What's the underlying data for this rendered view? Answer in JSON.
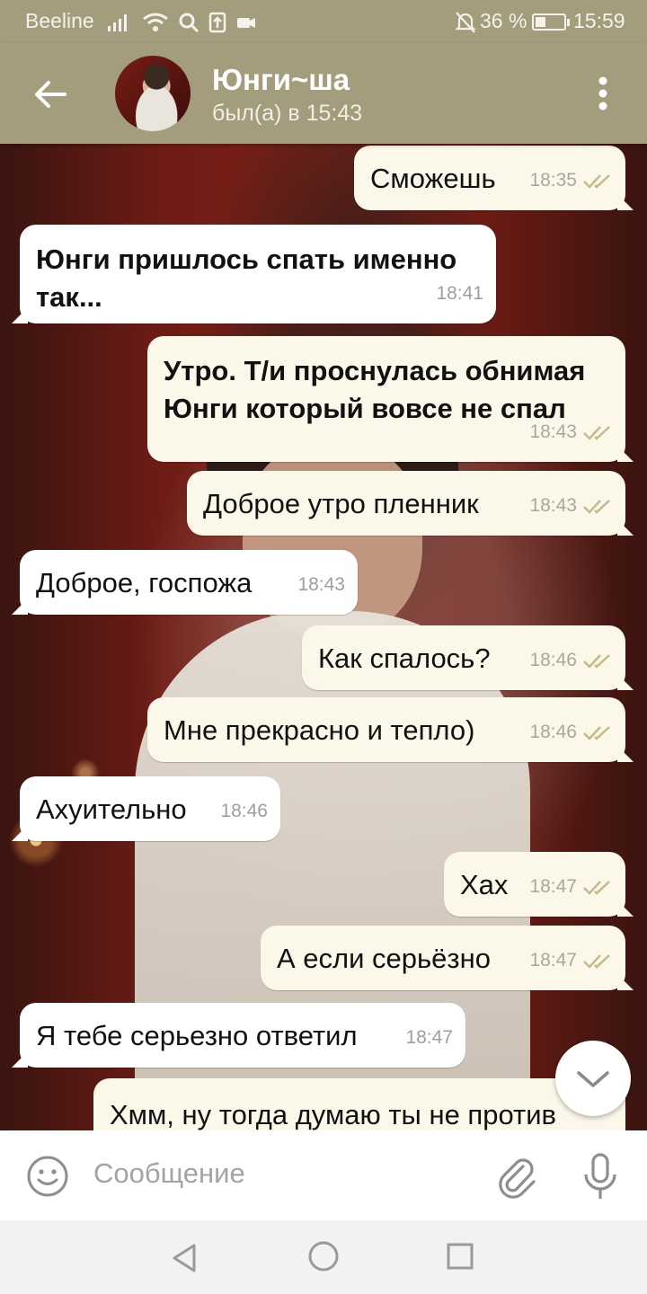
{
  "status_bar": {
    "carrier": "Beeline",
    "battery_percent": "36 %",
    "time": "15:59"
  },
  "header": {
    "contact_name": "Юнги~ша",
    "last_seen": "был(а) в 15:43"
  },
  "messages": [
    {
      "direction": "out",
      "text": "Сможешь",
      "time": "18:35"
    },
    {
      "direction": "in",
      "lines": [
        "Юнги пришлось спать именно",
        "так..."
      ],
      "time": "18:41"
    },
    {
      "direction": "out",
      "lines": [
        "Утро. Т/и проснулась обнимая",
        "Юнги который вовсе не спал"
      ],
      "time": "18:43"
    },
    {
      "direction": "out",
      "text": "Доброе утро пленник",
      "time": "18:43"
    },
    {
      "direction": "in",
      "text": "Доброе, госпожа",
      "time": "18:43"
    },
    {
      "direction": "out",
      "text": "Как спалось?",
      "time": "18:46"
    },
    {
      "direction": "out",
      "text": "Мне прекрасно и тепло)",
      "time": "18:46"
    },
    {
      "direction": "in",
      "text": "Ахуительно",
      "time": "18:46"
    },
    {
      "direction": "out",
      "text": "Хах",
      "time": "18:47"
    },
    {
      "direction": "out",
      "text": "А если серьёзно",
      "time": "18:47"
    },
    {
      "direction": "in",
      "text": "Я тебе серьезно ответил",
      "time": "18:47"
    },
    {
      "direction": "out",
      "text": "Хмм, ну тогда думаю ты не против"
    }
  ],
  "composer": {
    "placeholder": "Сообщение"
  },
  "colors": {
    "header_bg": "#a39c7d",
    "outgoing_bubble": "#fbf8ea",
    "incoming_bubble": "#ffffff",
    "read_checks": "#c5b98a"
  },
  "icons": {
    "back": "arrow-left-icon",
    "menu": "more-vert-icon",
    "emoji": "smile-icon",
    "attach": "paperclip-icon",
    "mic": "microphone-icon",
    "scroll_down": "chevron-down-icon"
  }
}
